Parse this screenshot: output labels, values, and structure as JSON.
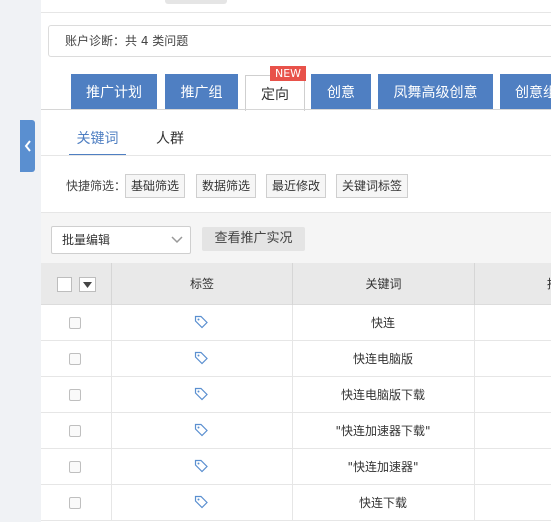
{
  "diagnosis": {
    "text": "账户诊断：共 4 类问题"
  },
  "tabs": [
    {
      "label": "推广计划"
    },
    {
      "label": "推广组"
    },
    {
      "label": "定向"
    },
    {
      "label": "创意"
    },
    {
      "label": "凤舞高级创意"
    },
    {
      "label": "创意组"
    }
  ],
  "new_badge": "NEW",
  "subtabs": [
    {
      "label": "关键词"
    },
    {
      "label": "人群"
    }
  ],
  "quick_filter": {
    "label": "快捷筛选：",
    "buttons": [
      "基础筛选",
      "数据筛选",
      "最近修改",
      "关键词标签"
    ]
  },
  "toolbar": {
    "batch_select": "批量编辑",
    "view_button": "查看推广实况"
  },
  "table": {
    "headers": [
      "标签",
      "关键词",
      "推"
    ],
    "rows": [
      {
        "keyword": "快连"
      },
      {
        "keyword": "快连电脑版"
      },
      {
        "keyword": "快连电脑版下载"
      },
      {
        "keyword": "\"快连加速器下载\""
      },
      {
        "keyword": "\"快连加速器\""
      },
      {
        "keyword": "快连下载"
      }
    ]
  },
  "colors": {
    "accent": "#4f7fc2",
    "badge": "#e8524a"
  },
  "icons": [
    "chevron-left-icon",
    "chevron-down-icon",
    "tag-icon",
    "checkbox-icon"
  ]
}
